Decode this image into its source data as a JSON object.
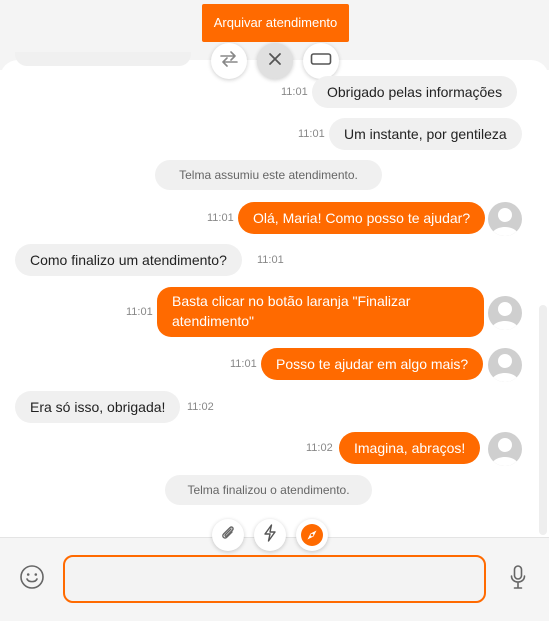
{
  "header": {
    "archive_label": "Arquivar atendimento",
    "icons": [
      "transfer-icon",
      "close-icon",
      "window-icon"
    ]
  },
  "messages": [
    {
      "side": "agent",
      "text": "Obrigado pelas informações",
      "time": "11:01"
    },
    {
      "side": "agent",
      "text": "Um instante, por gentileza",
      "time": "11:01"
    },
    {
      "side": "system",
      "text": "Telma assumiu este atendimento."
    },
    {
      "side": "agent",
      "text": "Olá, Maria! Como posso te ajudar?",
      "time": "11:01"
    },
    {
      "side": "customer",
      "text": "Como finalizo um atendimento?",
      "time": "11:01"
    },
    {
      "side": "agent",
      "text": "Basta clicar no botão laranja \"Finalizar atendimento\"",
      "time": "11:01"
    },
    {
      "side": "agent",
      "text": "Posso te ajudar em algo mais?",
      "time": "11:01"
    },
    {
      "side": "customer",
      "text": "Era só isso, obrigada!",
      "time": "11:02"
    },
    {
      "side": "agent",
      "text": "Imagina, abraços!",
      "time": "11:02"
    },
    {
      "side": "system",
      "text": "Telma finalizou o atendimento."
    }
  ],
  "toolbar": {
    "icons": [
      "paperclip-icon",
      "lightning-icon",
      "compass-icon",
      "emoji-icon",
      "microphone-icon"
    ]
  },
  "composer": {
    "value": "",
    "placeholder": ""
  },
  "colors": {
    "accent": "#ff6a00",
    "bubble_gray": "#f0f0f0",
    "system_text": "#666666"
  }
}
